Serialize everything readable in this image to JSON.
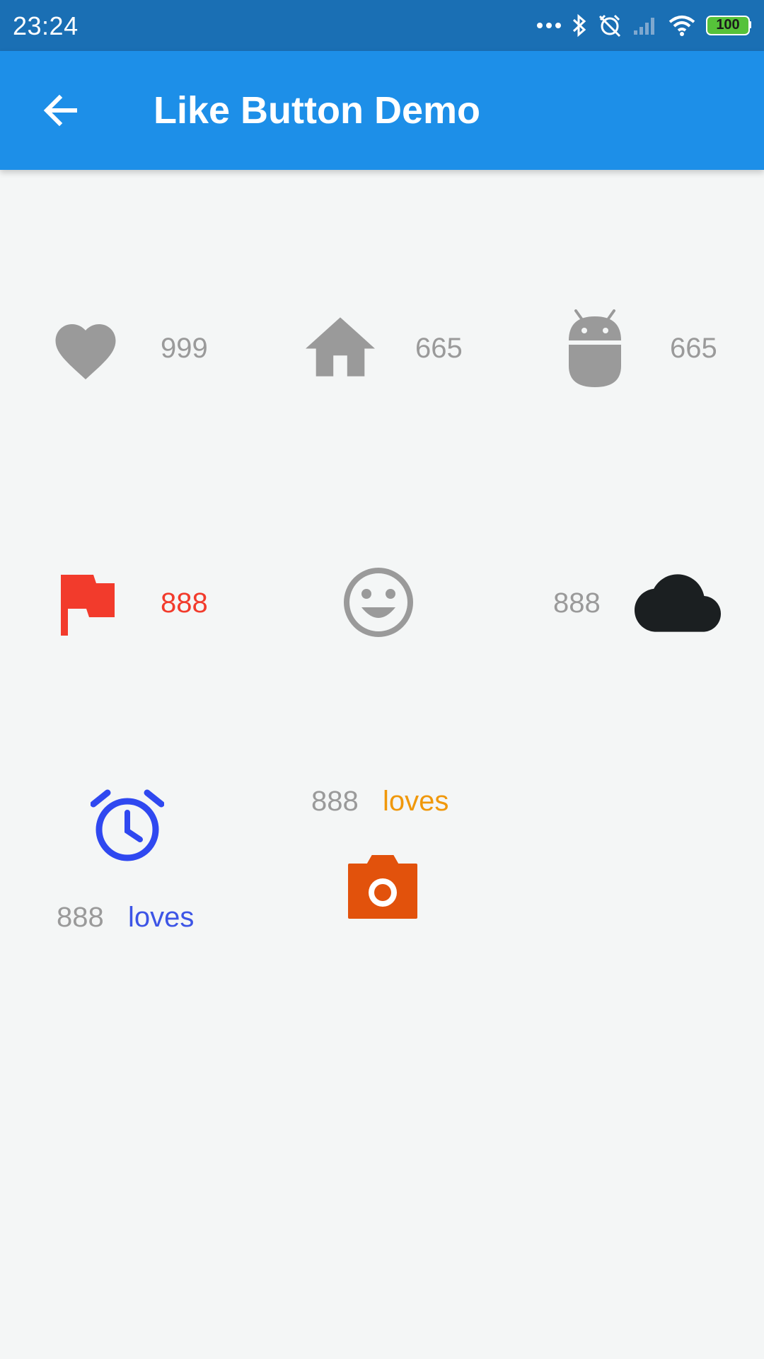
{
  "status_bar": {
    "time": "23:24",
    "battery": "100",
    "icons": [
      "more-dots-icon",
      "bluetooth-icon",
      "alarm-off-icon",
      "signal-icon",
      "wifi-icon",
      "battery-icon"
    ]
  },
  "app_bar": {
    "title": "Like Button Demo",
    "back_icon": "arrow-back-icon"
  },
  "like_buttons": [
    {
      "icon": "heart-icon",
      "count": "999",
      "color": "#9a9a9a"
    },
    {
      "icon": "home-icon",
      "count": "665",
      "color": "#9a9a9a"
    },
    {
      "icon": "android-icon",
      "count": "665",
      "color": "#9a9a9a"
    },
    {
      "icon": "flag-icon",
      "count": "888",
      "color": "#f23b2c"
    },
    {
      "icon": "smiley-icon",
      "color": "#9a9a9a"
    },
    {
      "icon": "cloud-icon",
      "count": "888",
      "color": "#1b1f21"
    },
    {
      "icon": "alarm-clock-icon",
      "count": "888",
      "label": "loves",
      "color": "#2f48f0",
      "label_color": "#3d55e6"
    },
    {
      "icon": "camera-icon",
      "count": "888",
      "label": "loves",
      "color": "#e2520c",
      "label_color": "#f0980b"
    }
  ]
}
